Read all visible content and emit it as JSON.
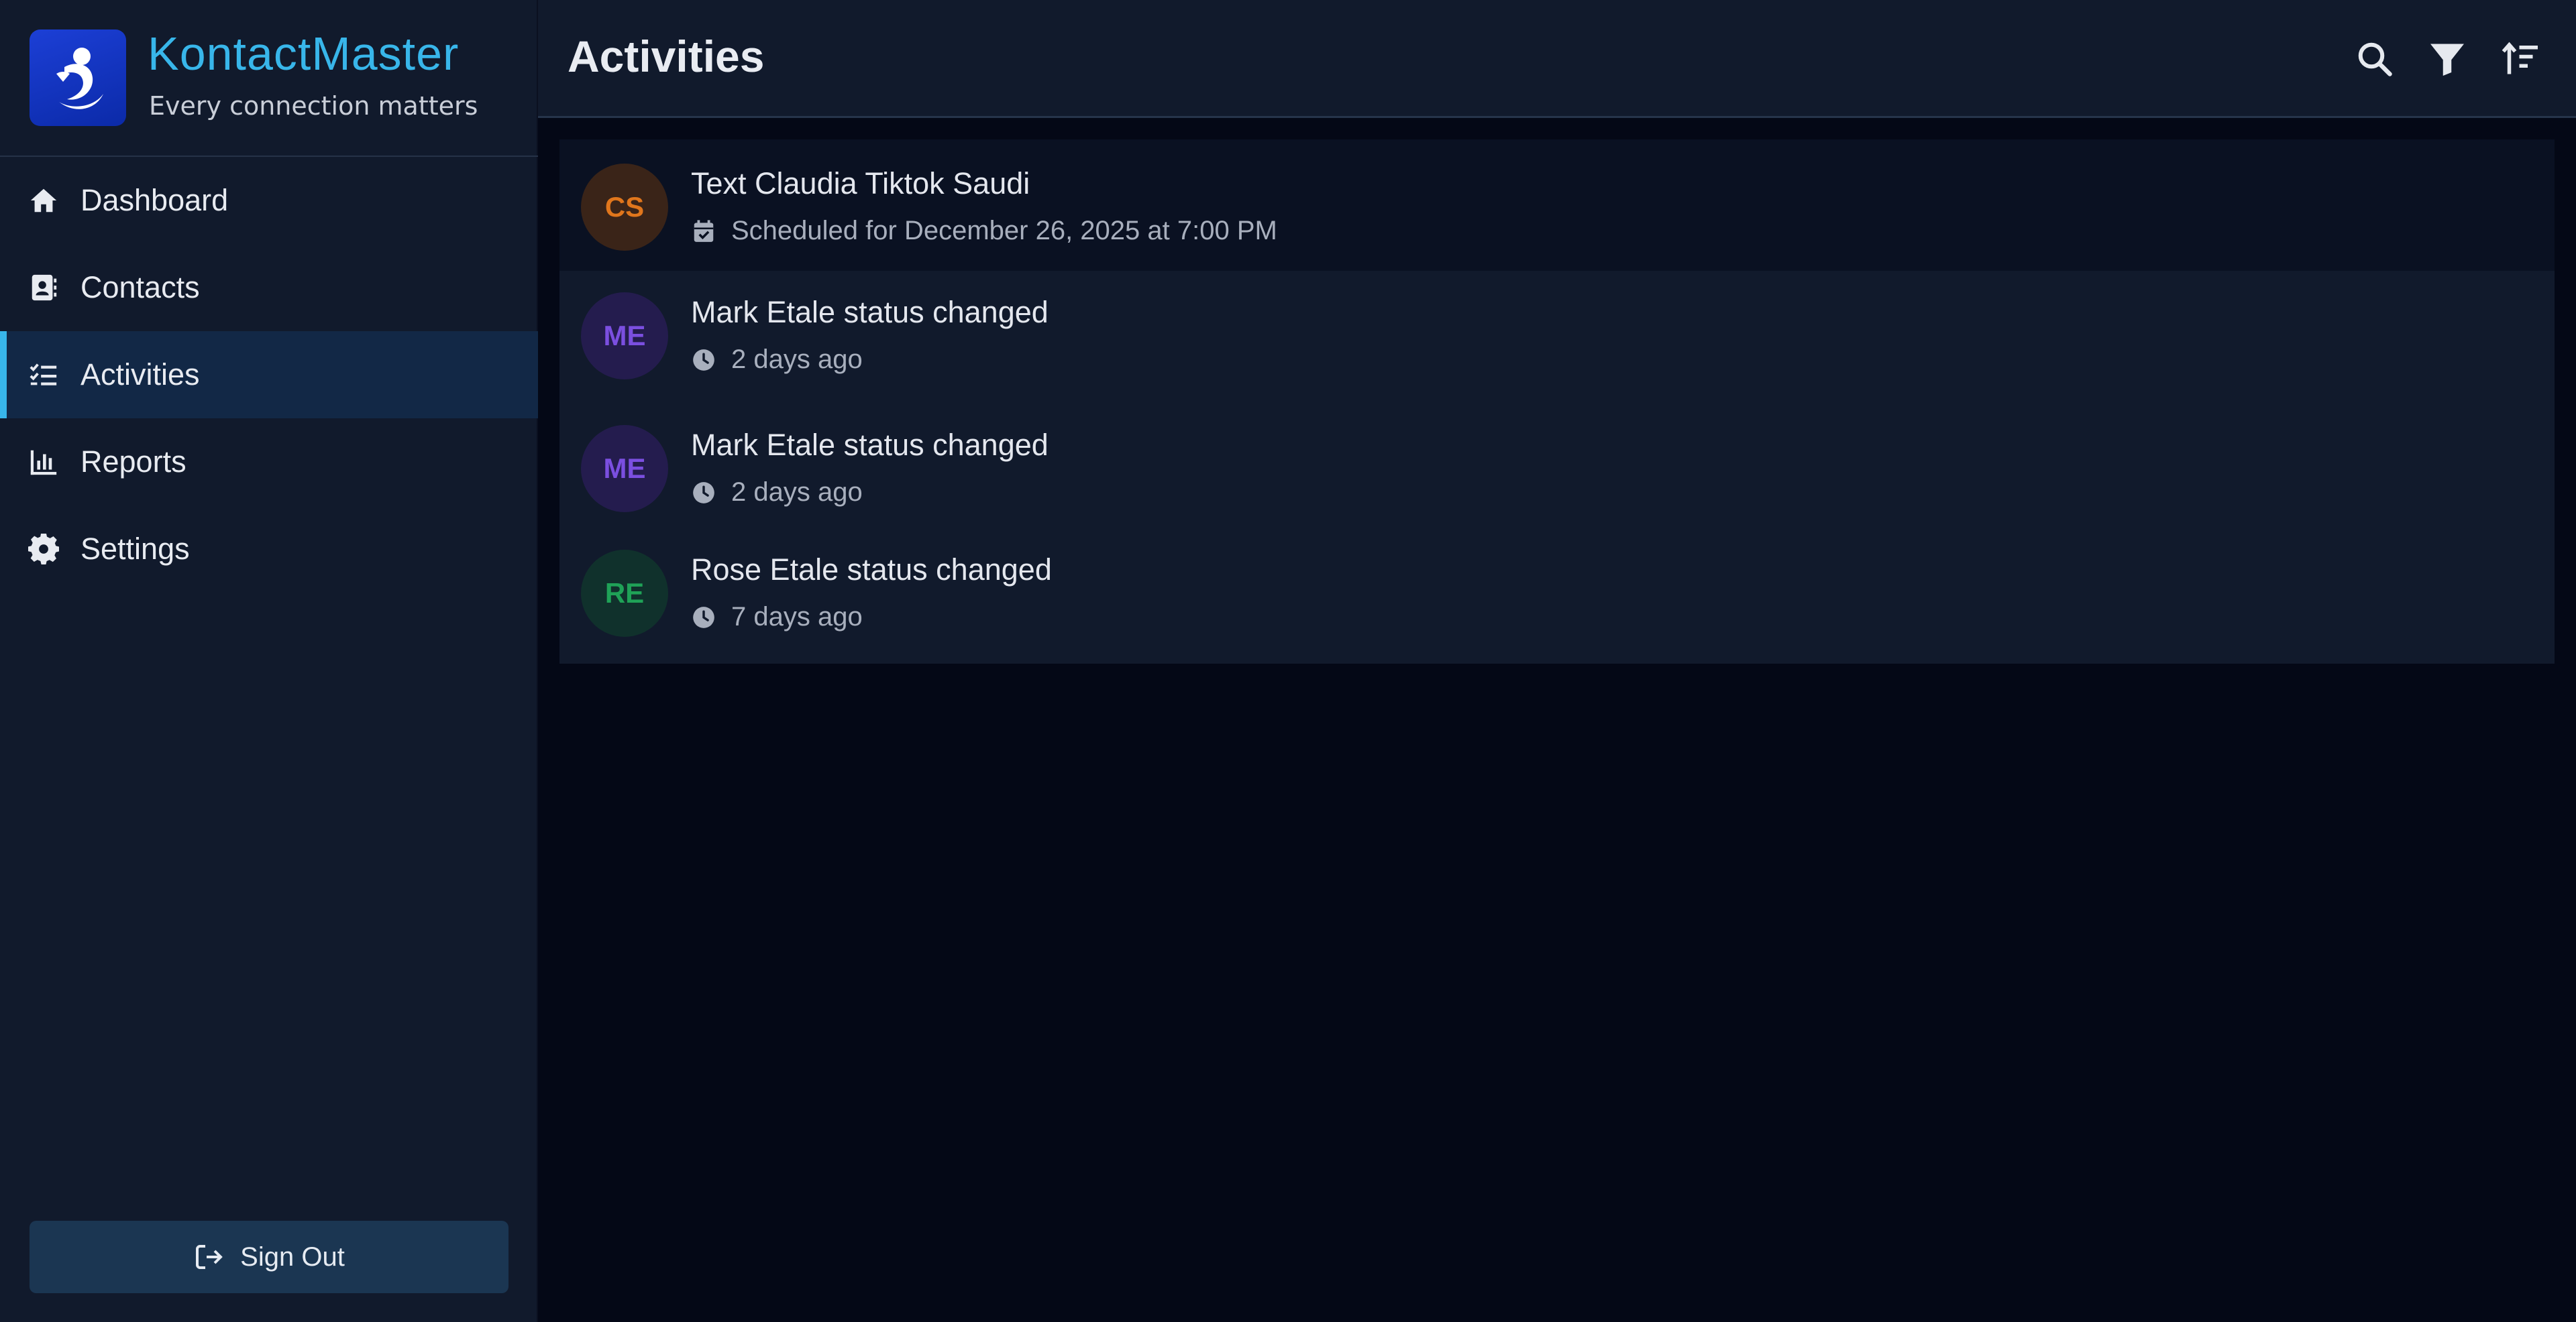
{
  "app": {
    "name": "KontactMaster",
    "tagline": "Every connection matters"
  },
  "sidebar": {
    "items": [
      {
        "label": "Dashboard",
        "icon": "home-icon",
        "active": false
      },
      {
        "label": "Contacts",
        "icon": "contact-card-icon",
        "active": false
      },
      {
        "label": "Activities",
        "icon": "task-list-icon",
        "active": true
      },
      {
        "label": "Reports",
        "icon": "bar-chart-icon",
        "active": false
      },
      {
        "label": "Settings",
        "icon": "gear-icon",
        "active": false
      }
    ],
    "signout_label": "Sign Out"
  },
  "header": {
    "title": "Activities",
    "actions": [
      "search-icon",
      "filter-icon",
      "sort-icon"
    ]
  },
  "activities": [
    {
      "initials": "CS",
      "title": "Text Claudia Tiktok Saudi",
      "meta": "Scheduled for December 26, 2025 at 7:00 PM",
      "meta_icon": "calendar-check-icon",
      "avatar_bg": "#3a2418",
      "avatar_fg": "#e0761c"
    },
    {
      "initials": "ME",
      "title": "Mark Etale status changed",
      "meta": "2 days ago",
      "meta_icon": "clock-icon",
      "avatar_bg": "#241c4e",
      "avatar_fg": "#7b4fe0"
    },
    {
      "initials": "ME",
      "title": "Mark Etale status changed",
      "meta": "2 days ago",
      "meta_icon": "clock-icon",
      "avatar_bg": "#241c4e",
      "avatar_fg": "#7b4fe0"
    },
    {
      "initials": "RE",
      "title": "Rose Etale status changed",
      "meta": "7 days ago",
      "meta_icon": "clock-icon",
      "avatar_bg": "#10312c",
      "avatar_fg": "#1fa257"
    }
  ],
  "colors": {
    "accent": "#38b6ea",
    "sidebar_bg": "#111a2c",
    "main_bg": "#040816"
  }
}
